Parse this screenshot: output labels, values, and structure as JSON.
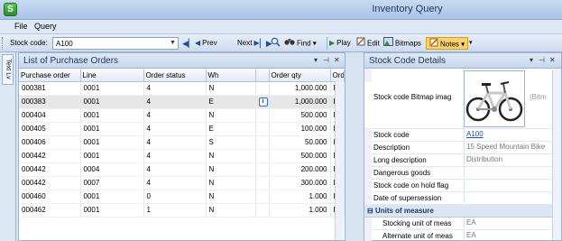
{
  "window": {
    "title": "Inventory Query"
  },
  "menu": {
    "items": [
      "File",
      "Query"
    ]
  },
  "toolbar": {
    "stock_code_label": "Stock code:",
    "stock_code_value": "A100",
    "prev_label": "Prev",
    "next_label": "Next",
    "find_label": "Find",
    "play_label": "Play",
    "edit_label": "Edit",
    "bitmaps_label": "Bitmaps",
    "notes_label": "Notes"
  },
  "side_tab": {
    "label": "Text Lv"
  },
  "po_panel": {
    "title": "List of Purchase Orders",
    "columns": [
      "Purchase order",
      "Line",
      "Order status",
      "Wh",
      "",
      "Order qty",
      "Order Uo"
    ],
    "rows": [
      [
        "000381",
        "0001",
        "4",
        "N",
        "",
        "1,000.000",
        "EA"
      ],
      [
        "000383",
        "0001",
        "4",
        "E",
        "",
        "1,000.000",
        "EA"
      ],
      [
        "000404",
        "0001",
        "4",
        "N",
        "",
        "500.000",
        "EA"
      ],
      [
        "000405",
        "0001",
        "4",
        "E",
        "",
        "100.000",
        "EA"
      ],
      [
        "000406",
        "0001",
        "4",
        "S",
        "",
        "50.000",
        "EA"
      ],
      [
        "000442",
        "0001",
        "4",
        "N",
        "",
        "500.000",
        "EA"
      ],
      [
        "000442",
        "0004",
        "4",
        "N",
        "",
        "200.000",
        "EA"
      ],
      [
        "000442",
        "0007",
        "4",
        "N",
        "",
        "300.000",
        "EA"
      ],
      [
        "000460",
        "0001",
        "0",
        "N",
        "",
        "1.000",
        "EA"
      ],
      [
        "000462",
        "0001",
        "1",
        "N",
        "",
        "1.000",
        "EA"
      ]
    ],
    "selected_row": 1
  },
  "details_panel": {
    "title": "Stock Code Details",
    "bitmap_label": "Stock code Bitmap imag",
    "bitmap_side_text": "(Bitm",
    "fields": [
      {
        "label": "Stock code",
        "value": "A100",
        "link": true
      },
      {
        "label": "Description",
        "value": "15 Speed Mountain Bike"
      },
      {
        "label": "Long description",
        "value": "Distribution"
      },
      {
        "label": "Dangerous goods",
        "value": ""
      },
      {
        "label": "Stock code on hold flag",
        "value": ""
      },
      {
        "label": "Date of supersession",
        "value": ""
      }
    ],
    "section": "Units of measure",
    "uom_fields": [
      {
        "label": "Stocking unit of meas",
        "value": "EA"
      },
      {
        "label": "Alternate unit of meas",
        "value": "EA"
      }
    ]
  },
  "colors": {
    "accent": "#ffd26b",
    "panel_header": "#c6d7ed",
    "link": "#1f4fb0"
  },
  "icons": [
    "app-icon",
    "first-icon",
    "prev-icon",
    "next-icon",
    "last-icon",
    "search-icon",
    "binoculars-icon",
    "play-icon",
    "edit-icon",
    "bitmaps-icon",
    "notes-icon",
    "info-icon",
    "bicycle-image"
  ]
}
